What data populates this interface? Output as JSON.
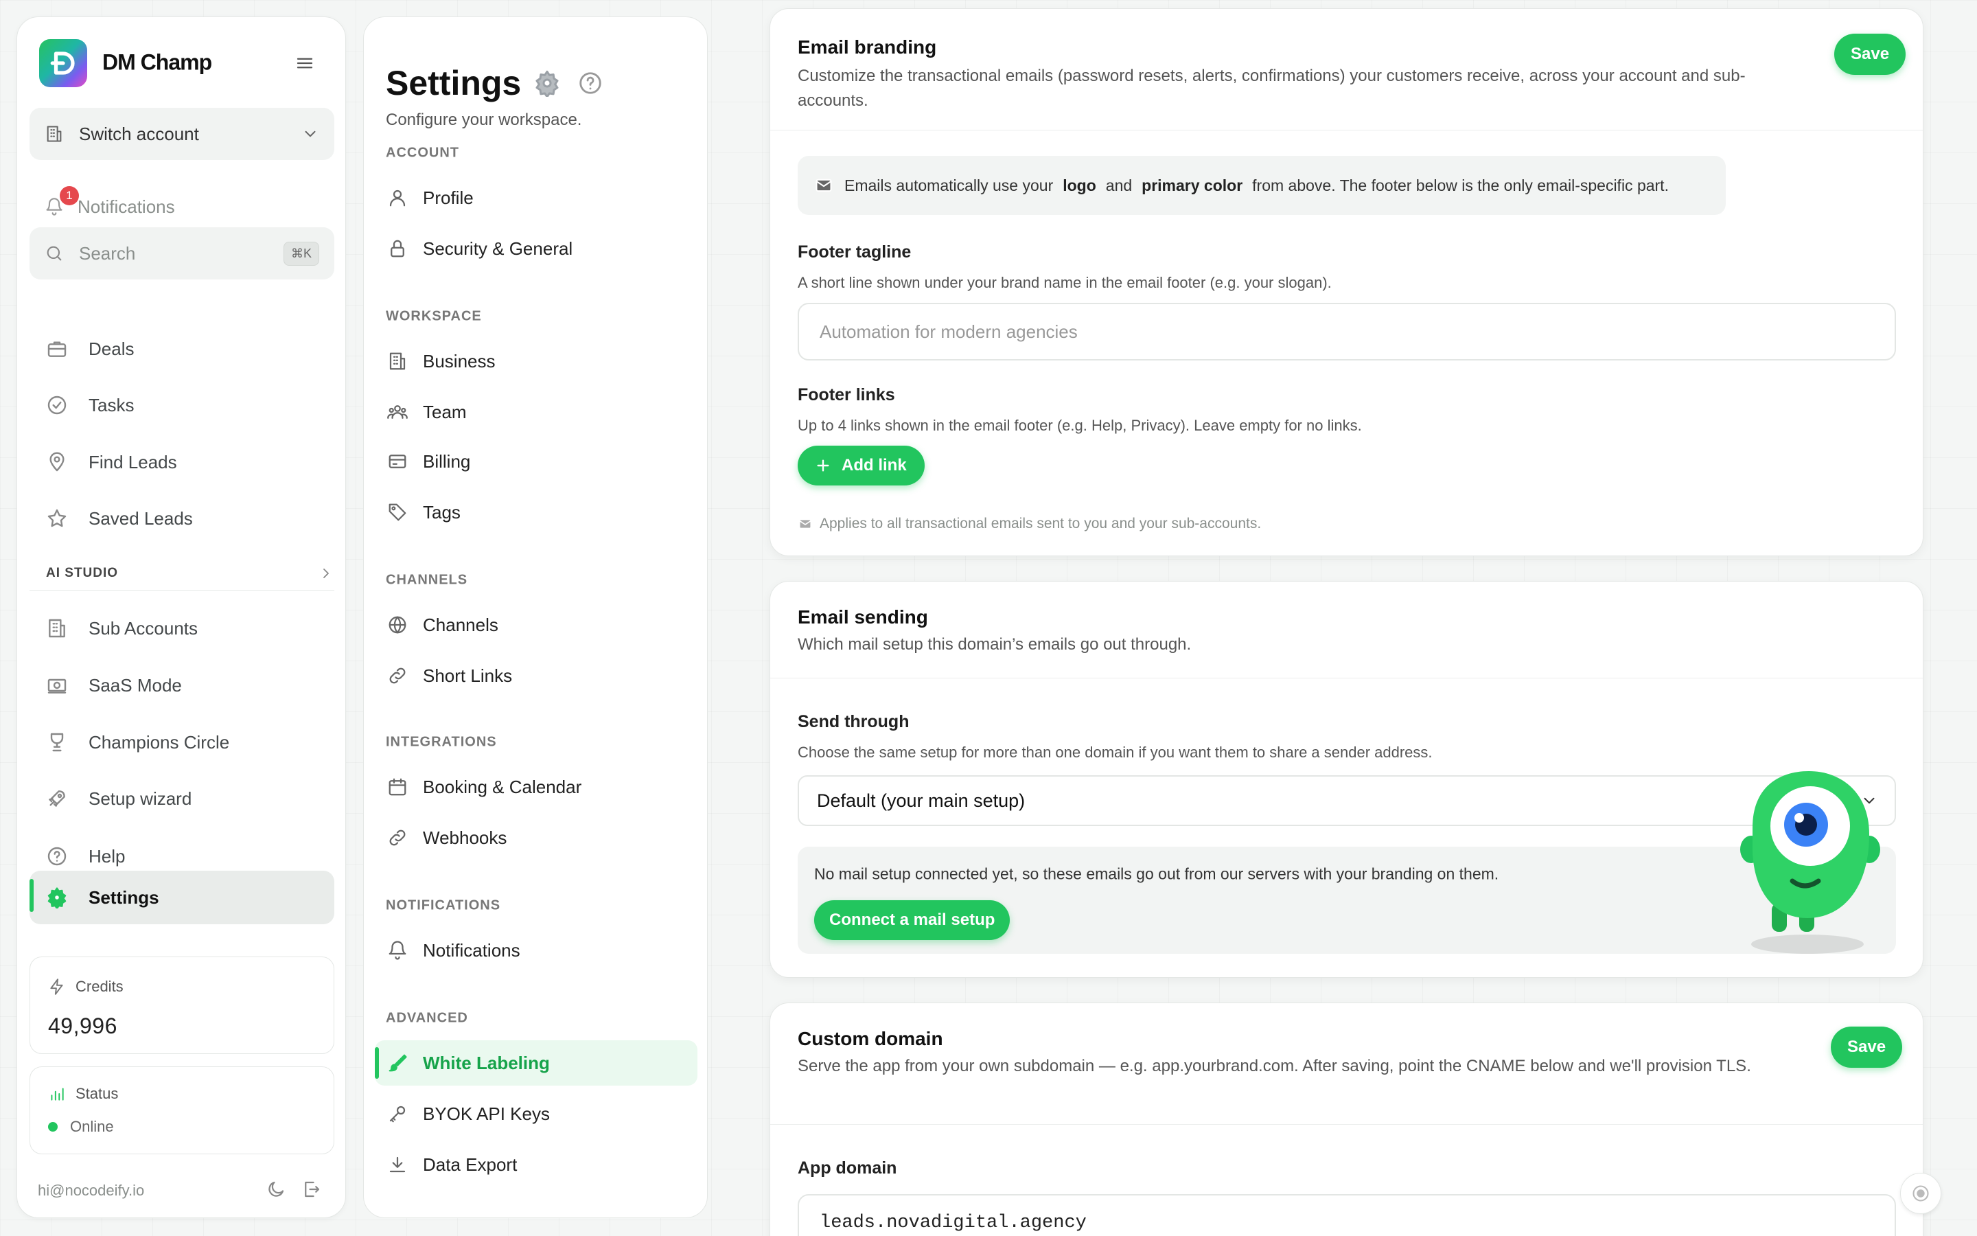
{
  "brand": {
    "name": "DM Champ"
  },
  "sidebar": {
    "switch_account": "Switch account",
    "notifications": {
      "label": "Notifications",
      "badge": "1"
    },
    "search": {
      "placeholder": "Search",
      "shortcut": "⌘K"
    },
    "items": [
      {
        "label": "Deals",
        "icon": "briefcase-icon"
      },
      {
        "label": "Tasks",
        "icon": "check-circle-icon"
      },
      {
        "label": "Find Leads",
        "icon": "map-pin-icon"
      },
      {
        "label": "Saved Leads",
        "icon": "star-icon"
      }
    ],
    "section_label": "AI STUDIO",
    "items2": [
      {
        "label": "Sub Accounts",
        "icon": "building-icon"
      },
      {
        "label": "SaaS Mode",
        "icon": "money-icon"
      },
      {
        "label": "Champions Circle",
        "icon": "trophy-icon"
      },
      {
        "label": "Setup wizard",
        "icon": "rocket-icon"
      },
      {
        "label": "Help",
        "icon": "help-circle-icon"
      },
      {
        "label": "Settings",
        "icon": "gear-icon",
        "active": true
      }
    ],
    "credits": {
      "label": "Credits",
      "value": "49,996"
    },
    "status": {
      "label": "Status",
      "value": "Online"
    },
    "user_email": "hi@nocodeify.io"
  },
  "settings": {
    "title": "Settings",
    "subtitle": "Configure your workspace.",
    "groups": [
      {
        "label": "ACCOUNT",
        "items": [
          "Profile",
          "Security & General"
        ]
      },
      {
        "label": "WORKSPACE",
        "items": [
          "Business",
          "Team",
          "Billing",
          "Tags"
        ]
      },
      {
        "label": "CHANNELS",
        "items": [
          "Channels",
          "Short Links"
        ]
      },
      {
        "label": "INTEGRATIONS",
        "items": [
          "Booking & Calendar",
          "Webhooks"
        ]
      },
      {
        "label": "NOTIFICATIONS",
        "items": [
          "Notifications"
        ]
      },
      {
        "label": "ADVANCED",
        "items": [
          "White Labeling",
          "BYOK API Keys",
          "Data Export"
        ]
      }
    ],
    "active_item": "White Labeling"
  },
  "email_branding": {
    "title": "Email branding",
    "description": "Customize the transactional emails (password resets, alerts, confirmations) your customers receive, across your account and sub-accounts.",
    "save_label": "Save",
    "info_prefix": "Emails automatically use your",
    "info_logo": "logo",
    "info_and": "and",
    "info_color": "primary color",
    "info_suffix": "from above. The footer below is the only email-specific part.",
    "tagline": {
      "label": "Footer tagline",
      "hint": "A short line shown under your brand name in the email footer (e.g. your slogan).",
      "placeholder": "Automation for modern agencies"
    },
    "links": {
      "label": "Footer links",
      "hint": "Up to 4 links shown in the email footer (e.g. Help, Privacy). Leave empty for no links.",
      "add_label": "Add link"
    },
    "applies_note": "Applies to all transactional emails sent to you and your sub-accounts."
  },
  "email_sending": {
    "title": "Email sending",
    "description": "Which mail setup this domain’s emails go out through.",
    "send_through": {
      "label": "Send through",
      "hint": "Choose the same setup for more than one domain if you want them to share a sender address.",
      "value": "Default (your main setup)"
    },
    "no_mail_text": "No mail setup connected yet, so these emails go out from our servers with your branding on them.",
    "connect_label": "Connect a mail setup"
  },
  "custom_domain": {
    "title": "Custom domain",
    "description": "Serve the app from your own subdomain — e.g. app.yourbrand.com. After saving, point the CNAME below and we'll provision TLS.",
    "save_label": "Save",
    "app_domain_label": "App domain",
    "app_domain_value": "leads.novadigital.agency"
  },
  "colors": {
    "accent": "#22c55e",
    "badge": "#e5484d"
  }
}
